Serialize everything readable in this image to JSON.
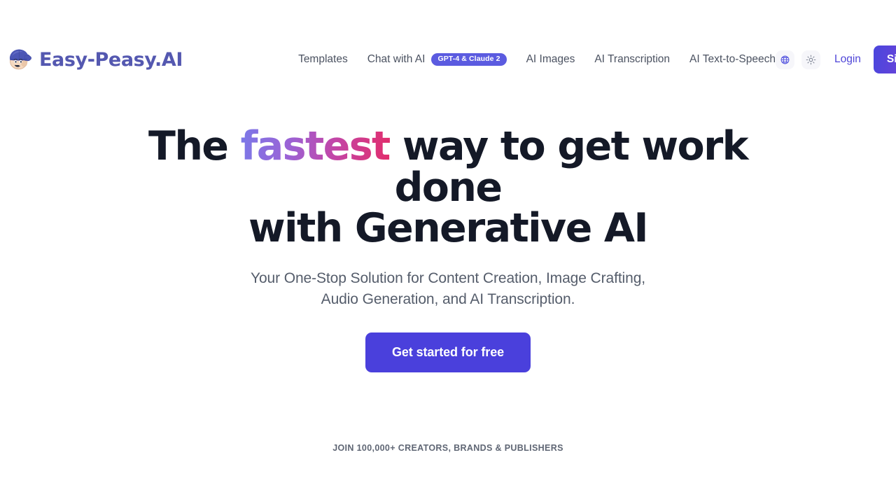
{
  "brand": {
    "name": "Easy-Peasy.AI",
    "logo_icon": "mascot-face-with-backwards-cap-icon",
    "color": "#5458b0"
  },
  "nav": {
    "items": [
      {
        "label": "Templates",
        "badge": null
      },
      {
        "label": "Chat with AI",
        "badge": "GPT-4 & Claude 2"
      },
      {
        "label": "AI Images",
        "badge": null
      },
      {
        "label": "AI Transcription",
        "badge": null
      },
      {
        "label": "AI Text-to-Speech",
        "badge": null
      }
    ],
    "badge_color": "#5b5be0"
  },
  "header_actions": {
    "language_icon": "globe-icon",
    "theme_icon": "sun-icon",
    "login_label": "Login",
    "login_color": "#4f46d8",
    "signup_label": "Sign up",
    "signup_gradient_from": "#4a46dd",
    "signup_gradient_to": "#8b3fd4"
  },
  "hero": {
    "headline_part1": "The ",
    "headline_highlight": "fastest",
    "headline_part2": " way to get work done",
    "headline_line2": "with Generative AI",
    "headline_color": "#141927",
    "highlight_gradient_from": "#7b79e8",
    "highlight_gradient_to": "#e22d6b",
    "subhead_line1": "Your One-Stop Solution for Content Creation, Image Crafting,",
    "subhead_line2": "Audio Generation, and AI Transcription.",
    "subhead_color": "#555d6b",
    "cta_label": "Get started for free",
    "cta_color": "#4a40dc"
  },
  "social_proof": {
    "text": "JOIN 100,000+ CREATORS, BRANDS & PUBLISHERS",
    "color": "#5f6674"
  }
}
